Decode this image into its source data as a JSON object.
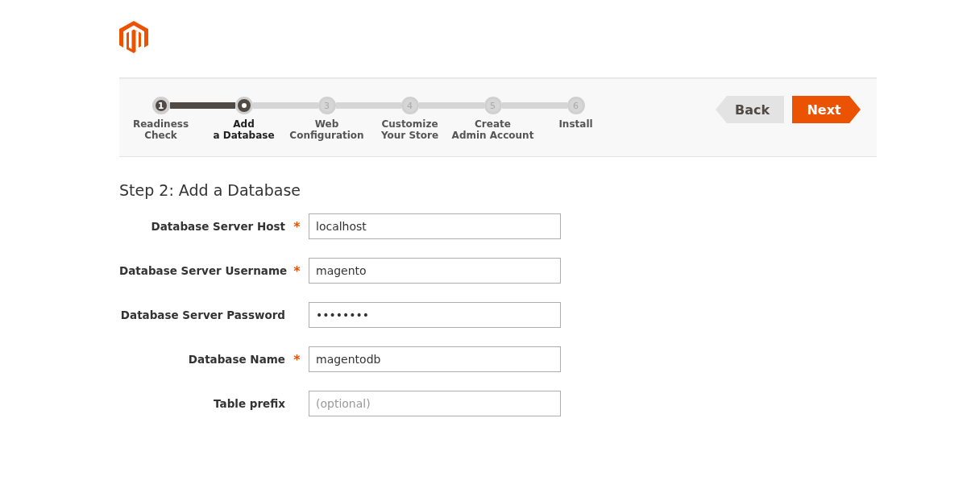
{
  "steps": [
    {
      "number": "1",
      "label": "Readiness",
      "label_line2": "Check",
      "completed": true,
      "selected": false
    },
    {
      "label": "Add",
      "label_line2": "a Database",
      "completed": false,
      "selected": true
    },
    {
      "number": "3",
      "label": "Web",
      "label_line2": "Configuration",
      "completed": false,
      "selected": false
    },
    {
      "number": "4",
      "label": "Customize",
      "label_line2": "Your Store",
      "completed": false,
      "selected": false
    },
    {
      "number": "5",
      "label": "Create",
      "label_line2": "Admin Account",
      "completed": false,
      "selected": false
    },
    {
      "number": "6",
      "label": "Install",
      "completed": false,
      "selected": false
    }
  ],
  "buttons": [
    {
      "label": "Back",
      "kind": "back"
    },
    {
      "label": "Next",
      "kind": "next"
    }
  ],
  "heading": "Step 2: Add a Database",
  "fields": [
    {
      "label": "Database Server Host",
      "required": true,
      "value": "localhost"
    },
    {
      "label": "Database Server Username",
      "required": true,
      "value": "magento"
    },
    {
      "label": "Database Server Password",
      "required": false,
      "value": "••••••••"
    },
    {
      "label": "Database Name",
      "required": true,
      "value": "magentodb"
    },
    {
      "label": "Table prefix",
      "required": false,
      "placeholder": "(optional)"
    }
  ],
  "required_mark": "*"
}
